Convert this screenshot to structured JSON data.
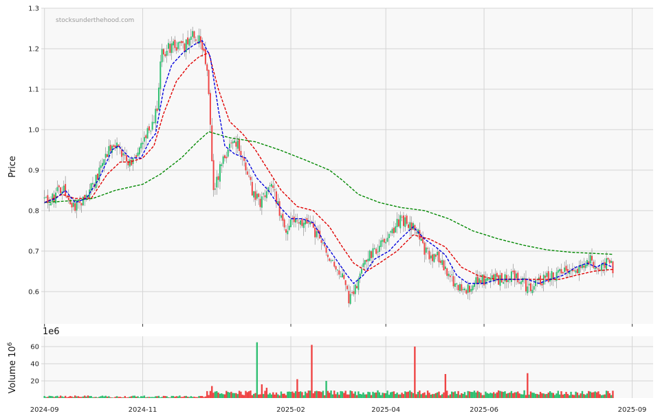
{
  "chart_data": [
    {
      "type": "candlestick",
      "watermark": "stocksunderthehood.com",
      "ylabel": "Price",
      "ylim": [
        0.52,
        1.3
      ],
      "yticks": [
        0.6,
        0.7,
        0.8,
        0.9,
        1.0,
        1.1,
        1.2,
        1.3
      ],
      "grid": true,
      "x_start": "2024-08-30",
      "x_end": "2025-09-14",
      "colors": {
        "up": "#2fbf71",
        "down": "#ef4444",
        "ma_fast": "#0000dd",
        "ma_mid": "#e00000",
        "ma_slow": "#008800"
      },
      "price_path": [
        [
          "2024-09-01",
          0.83
        ],
        [
          "2024-09-05",
          0.82
        ],
        [
          "2024-09-10",
          0.86
        ],
        [
          "2024-09-14",
          0.85
        ],
        [
          "2024-09-18",
          0.81
        ],
        [
          "2024-09-23",
          0.82
        ],
        [
          "2024-09-28",
          0.84
        ],
        [
          "2024-10-03",
          0.88
        ],
        [
          "2024-10-08",
          0.93
        ],
        [
          "2024-10-13",
          0.97
        ],
        [
          "2024-10-17",
          0.96
        ],
        [
          "2024-10-21",
          0.93
        ],
        [
          "2024-10-25",
          0.92
        ],
        [
          "2024-10-29",
          0.93
        ],
        [
          "2024-11-03",
          0.99
        ],
        [
          "2024-11-06",
          1.0
        ],
        [
          "2024-11-10",
          1.05
        ],
        [
          "2024-11-12",
          1.18
        ],
        [
          "2024-11-16",
          1.2
        ],
        [
          "2024-11-22",
          1.21
        ],
        [
          "2024-11-27",
          1.2
        ],
        [
          "2024-12-02",
          1.24
        ],
        [
          "2024-12-06",
          1.22
        ],
        [
          "2024-12-11",
          1.16
        ],
        [
          "2024-12-13",
          1.0
        ],
        [
          "2024-12-15",
          0.84
        ],
        [
          "2024-12-19",
          0.9
        ],
        [
          "2024-12-24",
          0.95
        ],
        [
          "2024-12-28",
          0.98
        ],
        [
          "2025-01-02",
          0.93
        ],
        [
          "2025-01-08",
          0.85
        ],
        [
          "2025-01-13",
          0.82
        ],
        [
          "2025-01-17",
          0.84
        ],
        [
          "2025-01-21",
          0.86
        ],
        [
          "2025-01-25",
          0.8
        ],
        [
          "2025-01-29",
          0.76
        ],
        [
          "2025-02-05",
          0.78
        ],
        [
          "2025-02-10",
          0.77
        ],
        [
          "2025-02-15",
          0.75
        ],
        [
          "2025-02-20",
          0.72
        ],
        [
          "2025-02-25",
          0.69
        ],
        [
          "2025-03-02",
          0.66
        ],
        [
          "2025-03-06",
          0.62
        ],
        [
          "2025-03-09",
          0.58
        ],
        [
          "2025-03-13",
          0.61
        ],
        [
          "2025-03-18",
          0.67
        ],
        [
          "2025-03-24",
          0.7
        ],
        [
          "2025-03-30",
          0.72
        ],
        [
          "2025-04-05",
          0.75
        ],
        [
          "2025-04-10",
          0.78
        ],
        [
          "2025-04-15",
          0.77
        ],
        [
          "2025-04-20",
          0.75
        ],
        [
          "2025-04-25",
          0.7
        ],
        [
          "2025-04-30",
          0.69
        ],
        [
          "2025-05-05",
          0.68
        ],
        [
          "2025-05-10",
          0.64
        ],
        [
          "2025-05-15",
          0.61
        ],
        [
          "2025-05-20",
          0.6
        ],
        [
          "2025-05-25",
          0.62
        ],
        [
          "2025-05-30",
          0.63
        ],
        [
          "2025-06-05",
          0.63
        ],
        [
          "2025-06-12",
          0.63
        ],
        [
          "2025-06-18",
          0.64
        ],
        [
          "2025-06-24",
          0.63
        ],
        [
          "2025-06-28",
          0.61
        ],
        [
          "2025-07-03",
          0.62
        ],
        [
          "2025-07-08",
          0.63
        ],
        [
          "2025-07-13",
          0.64
        ],
        [
          "2025-07-18",
          0.65
        ],
        [
          "2025-07-23",
          0.65
        ],
        [
          "2025-07-28",
          0.66
        ],
        [
          "2025-08-01",
          0.66
        ],
        [
          "2025-08-05",
          0.68
        ],
        [
          "2025-08-10",
          0.66
        ],
        [
          "2025-08-15",
          0.67
        ],
        [
          "2025-08-20",
          0.66
        ]
      ],
      "ma_fast": [
        [
          "2024-09-01",
          0.82
        ],
        [
          "2024-09-08",
          0.83
        ],
        [
          "2024-09-14",
          0.85
        ],
        [
          "2024-09-20",
          0.82
        ],
        [
          "2024-09-27",
          0.83
        ],
        [
          "2024-10-05",
          0.88
        ],
        [
          "2024-10-13",
          0.95
        ],
        [
          "2024-10-17",
          0.96
        ],
        [
          "2024-10-24",
          0.93
        ],
        [
          "2024-10-31",
          0.93
        ],
        [
          "2024-11-05",
          0.97
        ],
        [
          "2024-11-09",
          0.99
        ],
        [
          "2024-11-14",
          1.1
        ],
        [
          "2024-11-19",
          1.16
        ],
        [
          "2024-11-26",
          1.19
        ],
        [
          "2024-12-03",
          1.21
        ],
        [
          "2024-12-08",
          1.22
        ],
        [
          "2024-12-13",
          1.18
        ],
        [
          "2024-12-18",
          1.05
        ],
        [
          "2024-12-22",
          0.96
        ],
        [
          "2024-12-28",
          0.94
        ],
        [
          "2025-01-04",
          0.93
        ],
        [
          "2025-01-11",
          0.88
        ],
        [
          "2025-01-18",
          0.85
        ],
        [
          "2025-01-25",
          0.81
        ],
        [
          "2025-02-01",
          0.78
        ],
        [
          "2025-02-08",
          0.78
        ],
        [
          "2025-02-15",
          0.77
        ],
        [
          "2025-02-22",
          0.72
        ],
        [
          "2025-03-01",
          0.68
        ],
        [
          "2025-03-08",
          0.64
        ],
        [
          "2025-03-12",
          0.62
        ],
        [
          "2025-03-18",
          0.64
        ],
        [
          "2025-03-25",
          0.68
        ],
        [
          "2025-04-03",
          0.7
        ],
        [
          "2025-04-10",
          0.73
        ],
        [
          "2025-04-18",
          0.76
        ],
        [
          "2025-04-25",
          0.73
        ],
        [
          "2025-05-02",
          0.71
        ],
        [
          "2025-05-08",
          0.69
        ],
        [
          "2025-05-15",
          0.64
        ],
        [
          "2025-05-22",
          0.62
        ],
        [
          "2025-06-01",
          0.62
        ],
        [
          "2025-06-10",
          0.63
        ],
        [
          "2025-06-20",
          0.63
        ],
        [
          "2025-06-28",
          0.63
        ],
        [
          "2025-07-05",
          0.62
        ],
        [
          "2025-07-12",
          0.63
        ],
        [
          "2025-07-20",
          0.64
        ],
        [
          "2025-07-28",
          0.66
        ],
        [
          "2025-08-04",
          0.67
        ],
        [
          "2025-08-10",
          0.66
        ],
        [
          "2025-08-14",
          0.67
        ],
        [
          "2025-08-20",
          0.66
        ]
      ],
      "ma_mid": [
        [
          "2024-09-01",
          0.82
        ],
        [
          "2024-09-12",
          0.84
        ],
        [
          "2024-09-20",
          0.83
        ],
        [
          "2024-09-30",
          0.83
        ],
        [
          "2024-10-10",
          0.89
        ],
        [
          "2024-10-18",
          0.92
        ],
        [
          "2024-10-24",
          0.92
        ],
        [
          "2024-11-01",
          0.93
        ],
        [
          "2024-11-08",
          0.96
        ],
        [
          "2024-11-14",
          1.04
        ],
        [
          "2024-11-22",
          1.12
        ],
        [
          "2024-11-30",
          1.16
        ],
        [
          "2024-12-06",
          1.18
        ],
        [
          "2024-12-12",
          1.19
        ],
        [
          "2024-12-18",
          1.1
        ],
        [
          "2024-12-25",
          1.02
        ],
        [
          "2025-01-02",
          0.99
        ],
        [
          "2025-01-10",
          0.95
        ],
        [
          "2025-01-18",
          0.9
        ],
        [
          "2025-01-26",
          0.85
        ],
        [
          "2025-02-05",
          0.81
        ],
        [
          "2025-02-15",
          0.8
        ],
        [
          "2025-02-25",
          0.76
        ],
        [
          "2025-03-05",
          0.71
        ],
        [
          "2025-03-12",
          0.67
        ],
        [
          "2025-03-20",
          0.65
        ],
        [
          "2025-03-28",
          0.67
        ],
        [
          "2025-04-08",
          0.7
        ],
        [
          "2025-04-18",
          0.74
        ],
        [
          "2025-04-28",
          0.73
        ],
        [
          "2025-05-08",
          0.71
        ],
        [
          "2025-05-18",
          0.66
        ],
        [
          "2025-05-28",
          0.64
        ],
        [
          "2025-06-08",
          0.63
        ],
        [
          "2025-06-20",
          0.63
        ],
        [
          "2025-06-30",
          0.63
        ],
        [
          "2025-07-08",
          0.63
        ],
        [
          "2025-07-18",
          0.63
        ],
        [
          "2025-07-28",
          0.64
        ],
        [
          "2025-08-08",
          0.65
        ],
        [
          "2025-08-20",
          0.655
        ]
      ],
      "ma_slow": [
        [
          "2024-09-01",
          0.82
        ],
        [
          "2024-09-20",
          0.825
        ],
        [
          "2024-10-01",
          0.83
        ],
        [
          "2024-10-15",
          0.85
        ],
        [
          "2024-11-01",
          0.865
        ],
        [
          "2024-11-12",
          0.89
        ],
        [
          "2024-11-25",
          0.93
        ],
        [
          "2024-12-05",
          0.97
        ],
        [
          "2024-12-12",
          0.995
        ],
        [
          "2024-12-25",
          0.98
        ],
        [
          "2025-01-10",
          0.97
        ],
        [
          "2025-01-25",
          0.95
        ],
        [
          "2025-02-10",
          0.925
        ],
        [
          "2025-02-25",
          0.9
        ],
        [
          "2025-03-05",
          0.875
        ],
        [
          "2025-03-15",
          0.84
        ],
        [
          "2025-03-28",
          0.82
        ],
        [
          "2025-04-10",
          0.808
        ],
        [
          "2025-04-25",
          0.8
        ],
        [
          "2025-05-10",
          0.78
        ],
        [
          "2025-05-25",
          0.75
        ],
        [
          "2025-06-10",
          0.73
        ],
        [
          "2025-06-25",
          0.715
        ],
        [
          "2025-07-10",
          0.703
        ],
        [
          "2025-07-25",
          0.697
        ],
        [
          "2025-08-10",
          0.694
        ],
        [
          "2025-08-20",
          0.692
        ]
      ]
    },
    {
      "type": "bar",
      "ylabel": "Volume 10^6",
      "offset_label": "1e6",
      "ylim": [
        0,
        72
      ],
      "yticks": [
        20,
        40,
        60
      ],
      "grid": true,
      "spikes": [
        [
          "2024-12-14",
          14,
          "down"
        ],
        [
          "2025-01-11",
          65,
          "up"
        ],
        [
          "2025-01-14",
          16,
          "down"
        ],
        [
          "2025-01-17",
          12,
          "down"
        ],
        [
          "2025-02-05",
          22,
          "down"
        ],
        [
          "2025-02-14",
          62,
          "down"
        ],
        [
          "2025-02-23",
          20,
          "up"
        ],
        [
          "2025-04-19",
          60,
          "down"
        ],
        [
          "2025-05-08",
          28,
          "down"
        ],
        [
          "2025-06-28",
          29,
          "down"
        ]
      ],
      "xticks": [
        "2024-09",
        "2024-11",
        "2025-02",
        "2025-04",
        "2025-06",
        "2025-09"
      ]
    }
  ]
}
